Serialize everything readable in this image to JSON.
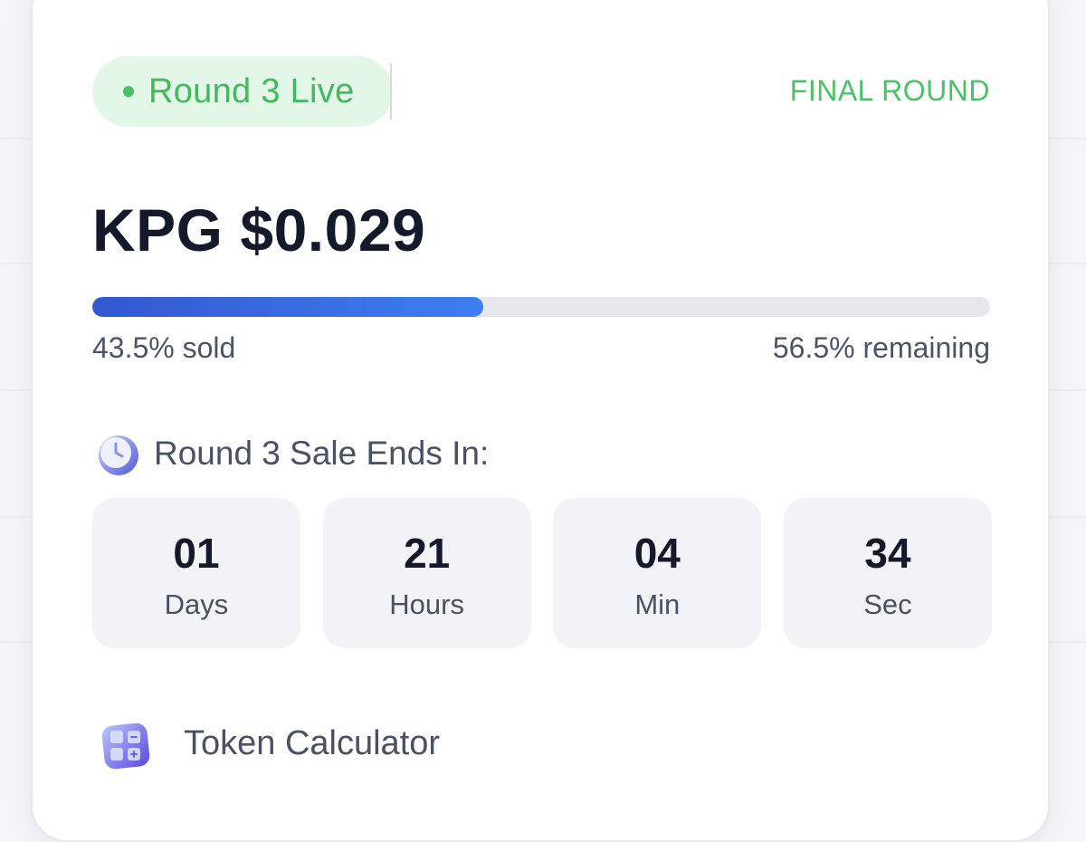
{
  "status": {
    "badge_label": "Round 3 Live",
    "round_tag": "FINAL ROUND"
  },
  "token": {
    "price_label": "KPG $0.029"
  },
  "progress": {
    "sold_fraction": 0.435,
    "sold_label": "43.5% sold",
    "remaining_label": "56.5% remaining"
  },
  "countdown": {
    "heading": "Round 3 Sale Ends In:",
    "units": [
      {
        "value": "01",
        "label": "Days"
      },
      {
        "value": "21",
        "label": "Hours"
      },
      {
        "value": "04",
        "label": "Min"
      },
      {
        "value": "34",
        "label": "Sec"
      }
    ]
  },
  "calculator": {
    "label": "Token Calculator"
  },
  "icons": {
    "live": "status-dot-icon",
    "timer": "clock-icon",
    "calculator": "calculator-icon"
  },
  "colors": {
    "accent_green": "#43b85d",
    "badge_bg": "#e3f7e8",
    "progress_blue": "#3d7ef0",
    "text_dark": "#151a2b"
  }
}
